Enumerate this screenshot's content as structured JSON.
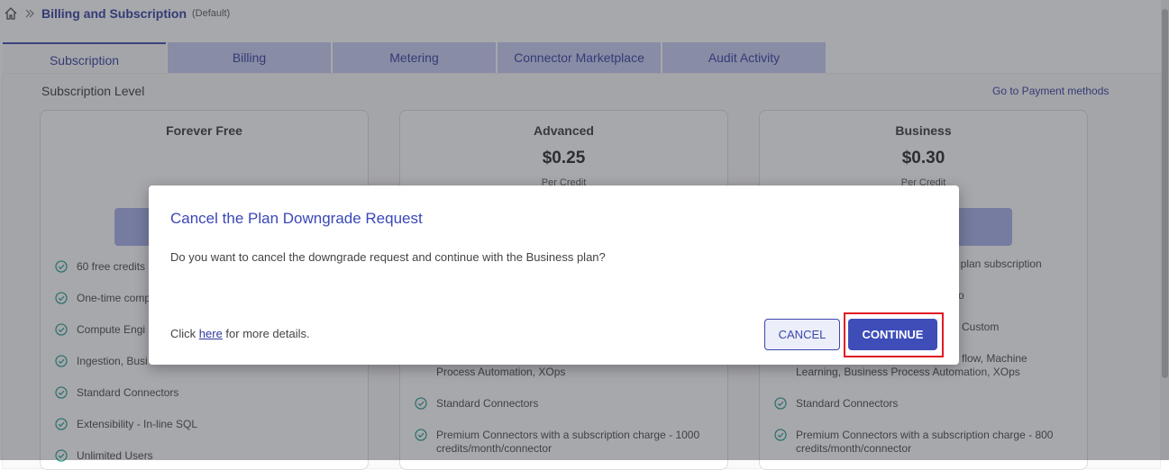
{
  "breadcrumb": {
    "title": "Billing and Subscription",
    "suffix": "(Default)",
    "home_icon": "home-icon",
    "separator_icon": "double-chevron-right-icon"
  },
  "tabs": [
    {
      "label": "Subscription",
      "active": true
    },
    {
      "label": "Billing"
    },
    {
      "label": "Metering"
    },
    {
      "label": "Connector Marketplace"
    },
    {
      "label": "Audit Activity"
    }
  ],
  "section": {
    "title": "Subscription Level",
    "payment_link": "Go to Payment methods"
  },
  "plans": [
    {
      "name": "Forever Free",
      "price": "",
      "per": "",
      "features": [
        "60 free credits",
        "One-time comp",
        "Compute Engi",
        "Ingestion, Busi",
        "Standard Connectors",
        "Extensibility - In-line SQL",
        "Unlimited Users"
      ]
    },
    {
      "name": "Advanced",
      "price": "$0.25",
      "per": "Per Credit",
      "features": [
        "Process Automation, XOps",
        "Standard Connectors",
        "Premium Connectors with a subscription charge - 1000",
        "credits/month/connector"
      ]
    },
    {
      "name": "Business",
      "price": "$0.30",
      "per": "Per Credit",
      "features": [
        "st plan subscription",
        "o",
        "Custom",
        "flow, Machine",
        "Learning, Business Process Automation, XOps",
        "Standard Connectors",
        "Premium Connectors with a subscription charge - 800",
        "credits/month/connector"
      ]
    }
  ],
  "modal": {
    "title": "Cancel the Plan Downgrade Request",
    "body": "Do you want to cancel the downgrade request and continue with the Business plan?",
    "footer_prefix": "Click ",
    "footer_link": "here",
    "footer_suffix": " for more details.",
    "cancel_label": "CANCEL",
    "continue_label": "CONTINUE"
  },
  "colors": {
    "accent": "#3e4db8",
    "highlight": "#e01b24",
    "check": "#2a9d8f"
  }
}
